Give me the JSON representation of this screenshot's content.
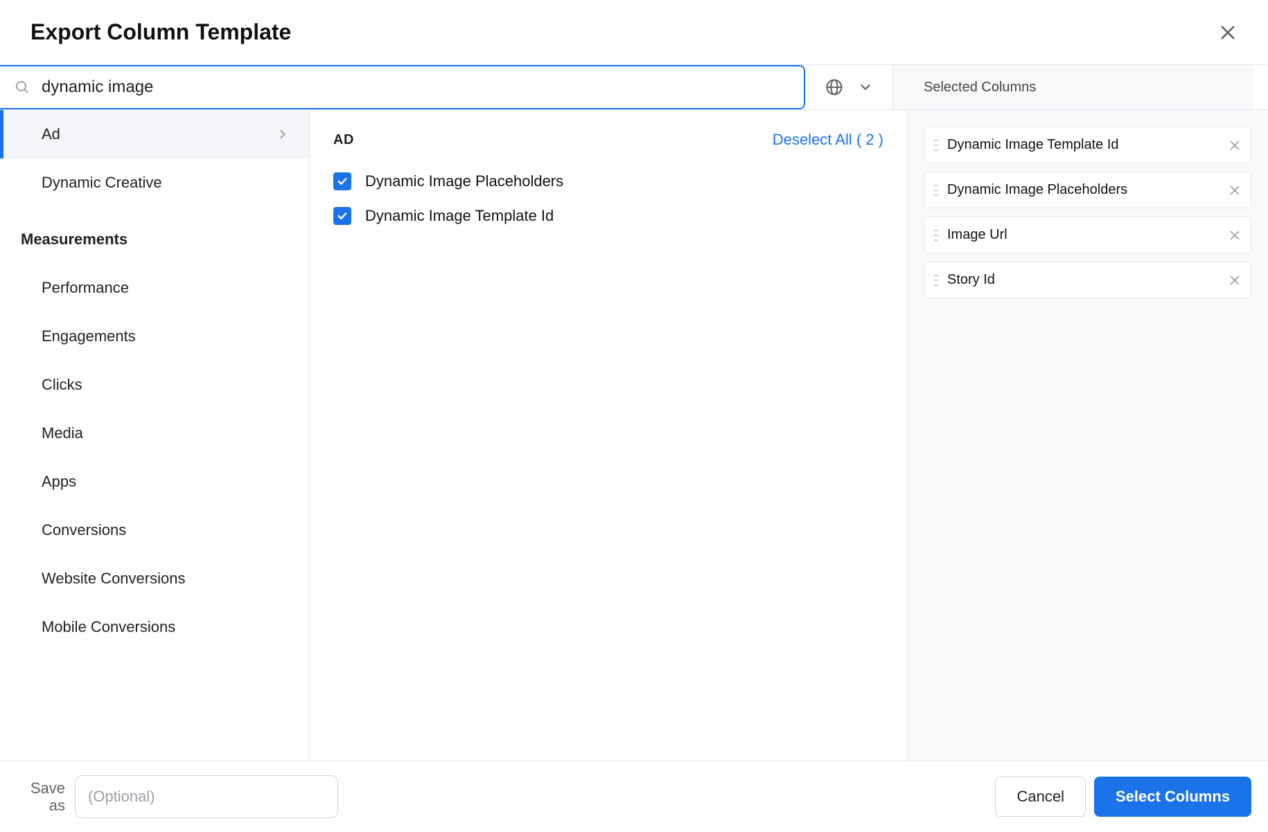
{
  "header": {
    "title": "Export Column Template"
  },
  "search": {
    "value": "dynamic image"
  },
  "sidebar": {
    "top": [
      {
        "label": "Ad",
        "active": true,
        "has_arrow": true
      },
      {
        "label": "Dynamic Creative",
        "active": false,
        "has_arrow": false
      }
    ],
    "section_title": "Measurements",
    "items": [
      {
        "label": "Performance"
      },
      {
        "label": "Engagements"
      },
      {
        "label": "Clicks"
      },
      {
        "label": "Media"
      },
      {
        "label": "Apps"
      },
      {
        "label": "Conversions"
      },
      {
        "label": "Website Conversions"
      },
      {
        "label": "Mobile Conversions"
      }
    ]
  },
  "center": {
    "section_title": "AD",
    "deselect_label": "Deselect All ( 2 )",
    "options": [
      {
        "label": "Dynamic Image Placeholders",
        "checked": true
      },
      {
        "label": "Dynamic Image Template Id",
        "checked": true
      }
    ]
  },
  "selected": {
    "title": "Selected Columns",
    "chips": [
      {
        "label": "Dynamic Image Template Id"
      },
      {
        "label": "Dynamic Image Placeholders"
      },
      {
        "label": "Image Url"
      },
      {
        "label": "Story Id"
      }
    ]
  },
  "footer": {
    "saveas_label": "Save as",
    "saveas_placeholder": "(Optional)",
    "cancel": "Cancel",
    "confirm": "Select Columns"
  }
}
